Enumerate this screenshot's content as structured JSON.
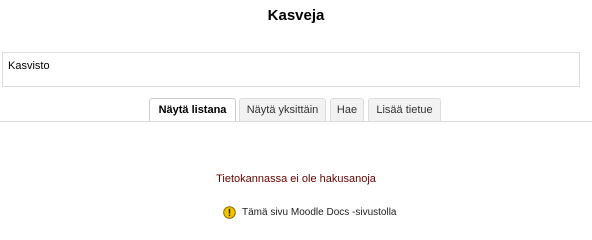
{
  "page": {
    "title": "Kasveja"
  },
  "intro": {
    "text": "Kasvisto"
  },
  "tabs": [
    {
      "label": "Näytä listana",
      "active": true
    },
    {
      "label": "Näytä yksittäin",
      "active": false
    },
    {
      "label": "Hae",
      "active": false
    },
    {
      "label": "Lisää tietue",
      "active": false
    }
  ],
  "content": {
    "empty_message": "Tietokannassa ei ole hakusanoja"
  },
  "footer": {
    "docs_link": "Tämä sivu Moodle Docs -sivustolla",
    "docs_icon": "warning-help-icon"
  },
  "colors": {
    "empty_message": "#660000",
    "border": "#dddddd",
    "icon_fill": "#f5c400"
  }
}
